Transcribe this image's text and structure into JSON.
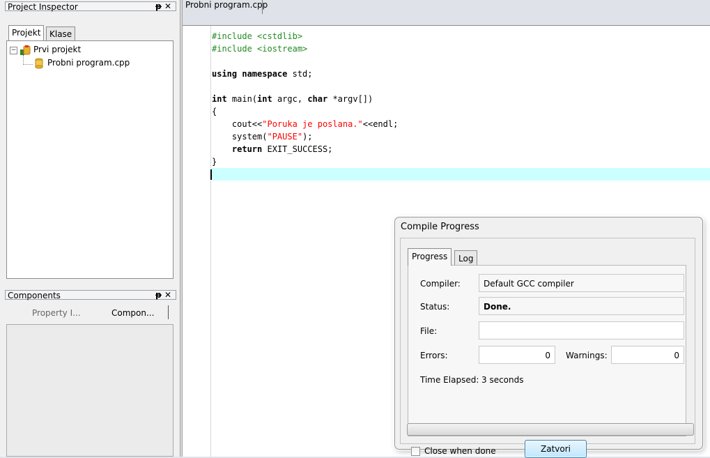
{
  "project_inspector": {
    "title": "Project Inspector",
    "buttons": "4 ✕",
    "tabs": [
      "Projekt",
      "Klase"
    ],
    "tree": {
      "project": "Prvi projekt",
      "file": "Probni program.cpp"
    }
  },
  "components": {
    "title": "Components",
    "tabs": [
      "Property I...",
      "Compon..."
    ]
  },
  "editor": {
    "tab": "Probni program.cpp",
    "lines": [
      [
        {
          "t": "#include <cstdlib>",
          "c": "pp"
        }
      ],
      [
        {
          "t": "#include <iostream>",
          "c": "pp"
        }
      ],
      [
        {
          "t": "",
          "c": ""
        }
      ],
      [
        {
          "t": "using namespace",
          "c": "kw"
        },
        {
          "t": " std;",
          "c": ""
        }
      ],
      [
        {
          "t": "",
          "c": ""
        }
      ],
      [
        {
          "t": "int",
          "c": "kw"
        },
        {
          "t": " main(",
          "c": ""
        },
        {
          "t": "int",
          "c": "kw"
        },
        {
          "t": " argc, ",
          "c": ""
        },
        {
          "t": "char",
          "c": "kw"
        },
        {
          "t": " *argv[])",
          "c": ""
        }
      ],
      [
        {
          "t": "{",
          "c": ""
        }
      ],
      [
        {
          "t": "    cout<<",
          "c": ""
        },
        {
          "t": "\"Poruka je poslana.\"",
          "c": "str"
        },
        {
          "t": "<<endl;",
          "c": ""
        }
      ],
      [
        {
          "t": "    system(",
          "c": ""
        },
        {
          "t": "\"PAUSE\"",
          "c": "str"
        },
        {
          "t": ");",
          "c": ""
        }
      ],
      [
        {
          "t": "    ",
          "c": ""
        },
        {
          "t": "return",
          "c": "kw"
        },
        {
          "t": " EXIT_SUCCESS;",
          "c": ""
        }
      ],
      [
        {
          "t": "}",
          "c": ""
        }
      ]
    ],
    "current_line_highlight": "#ccffff"
  },
  "dialog": {
    "title": "Compile Progress",
    "tabs": [
      "Progress",
      "Log"
    ],
    "compiler_label": "Compiler:",
    "compiler_value": "Default GCC compiler",
    "status_label": "Status:",
    "status_value": "Done.",
    "file_label": "File:",
    "file_value": "",
    "errors_label": "Errors:",
    "errors_value": "0",
    "warnings_label": "Warnings:",
    "warnings_value": "0",
    "elapsed_label": "Time Elapsed:",
    "elapsed_value": "3 seconds",
    "progress_fraction": 0,
    "close_when_done_label": "Close when done",
    "close_when_done_checked": false,
    "button_label": "Zatvori"
  }
}
